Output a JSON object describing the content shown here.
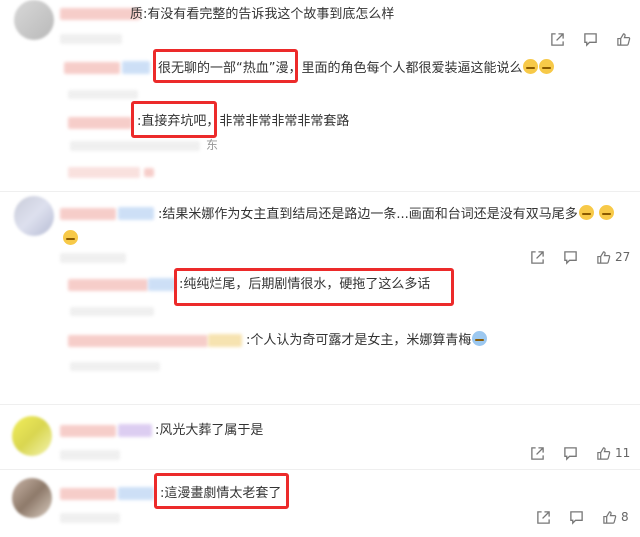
{
  "comments": [
    {
      "id": "c1",
      "text_suffix": "质:有没有看完整的告诉我这个故事到底怎么样"
    },
    {
      "id": "c2",
      "text": ":结果米娜作为女主直到结局还是路边一条...画面和台词还是没有双马尾多",
      "likes": "27"
    },
    {
      "id": "c3",
      "text": ":风光大葬了属于是",
      "likes": "11"
    },
    {
      "id": "c4",
      "text": ":這漫畫劇情太老套了",
      "likes": "8"
    }
  ],
  "replies": [
    {
      "id": "r1",
      "text": "很无聊的一部“热血”漫，里面的角色每个人都很爱装逼这能说么"
    },
    {
      "id": "r2",
      "text": ":直接弃坑吧，非常非常非常非常套路",
      "fragment": "东"
    },
    {
      "id": "r3",
      "text": ":纯纯烂尾，后期剧情很水，硬拖了这么多话"
    },
    {
      "id": "r4",
      "text": ":个人认为奇可露才是女主，米娜算青梅"
    }
  ],
  "icons": {
    "share": "share-icon",
    "comment": "comment-icon",
    "like": "thumbs-up-icon",
    "emoji": "emoji-icon"
  },
  "colors": {
    "highlight": "#ec2a2a",
    "text": "#333333",
    "meta": "#666666"
  }
}
